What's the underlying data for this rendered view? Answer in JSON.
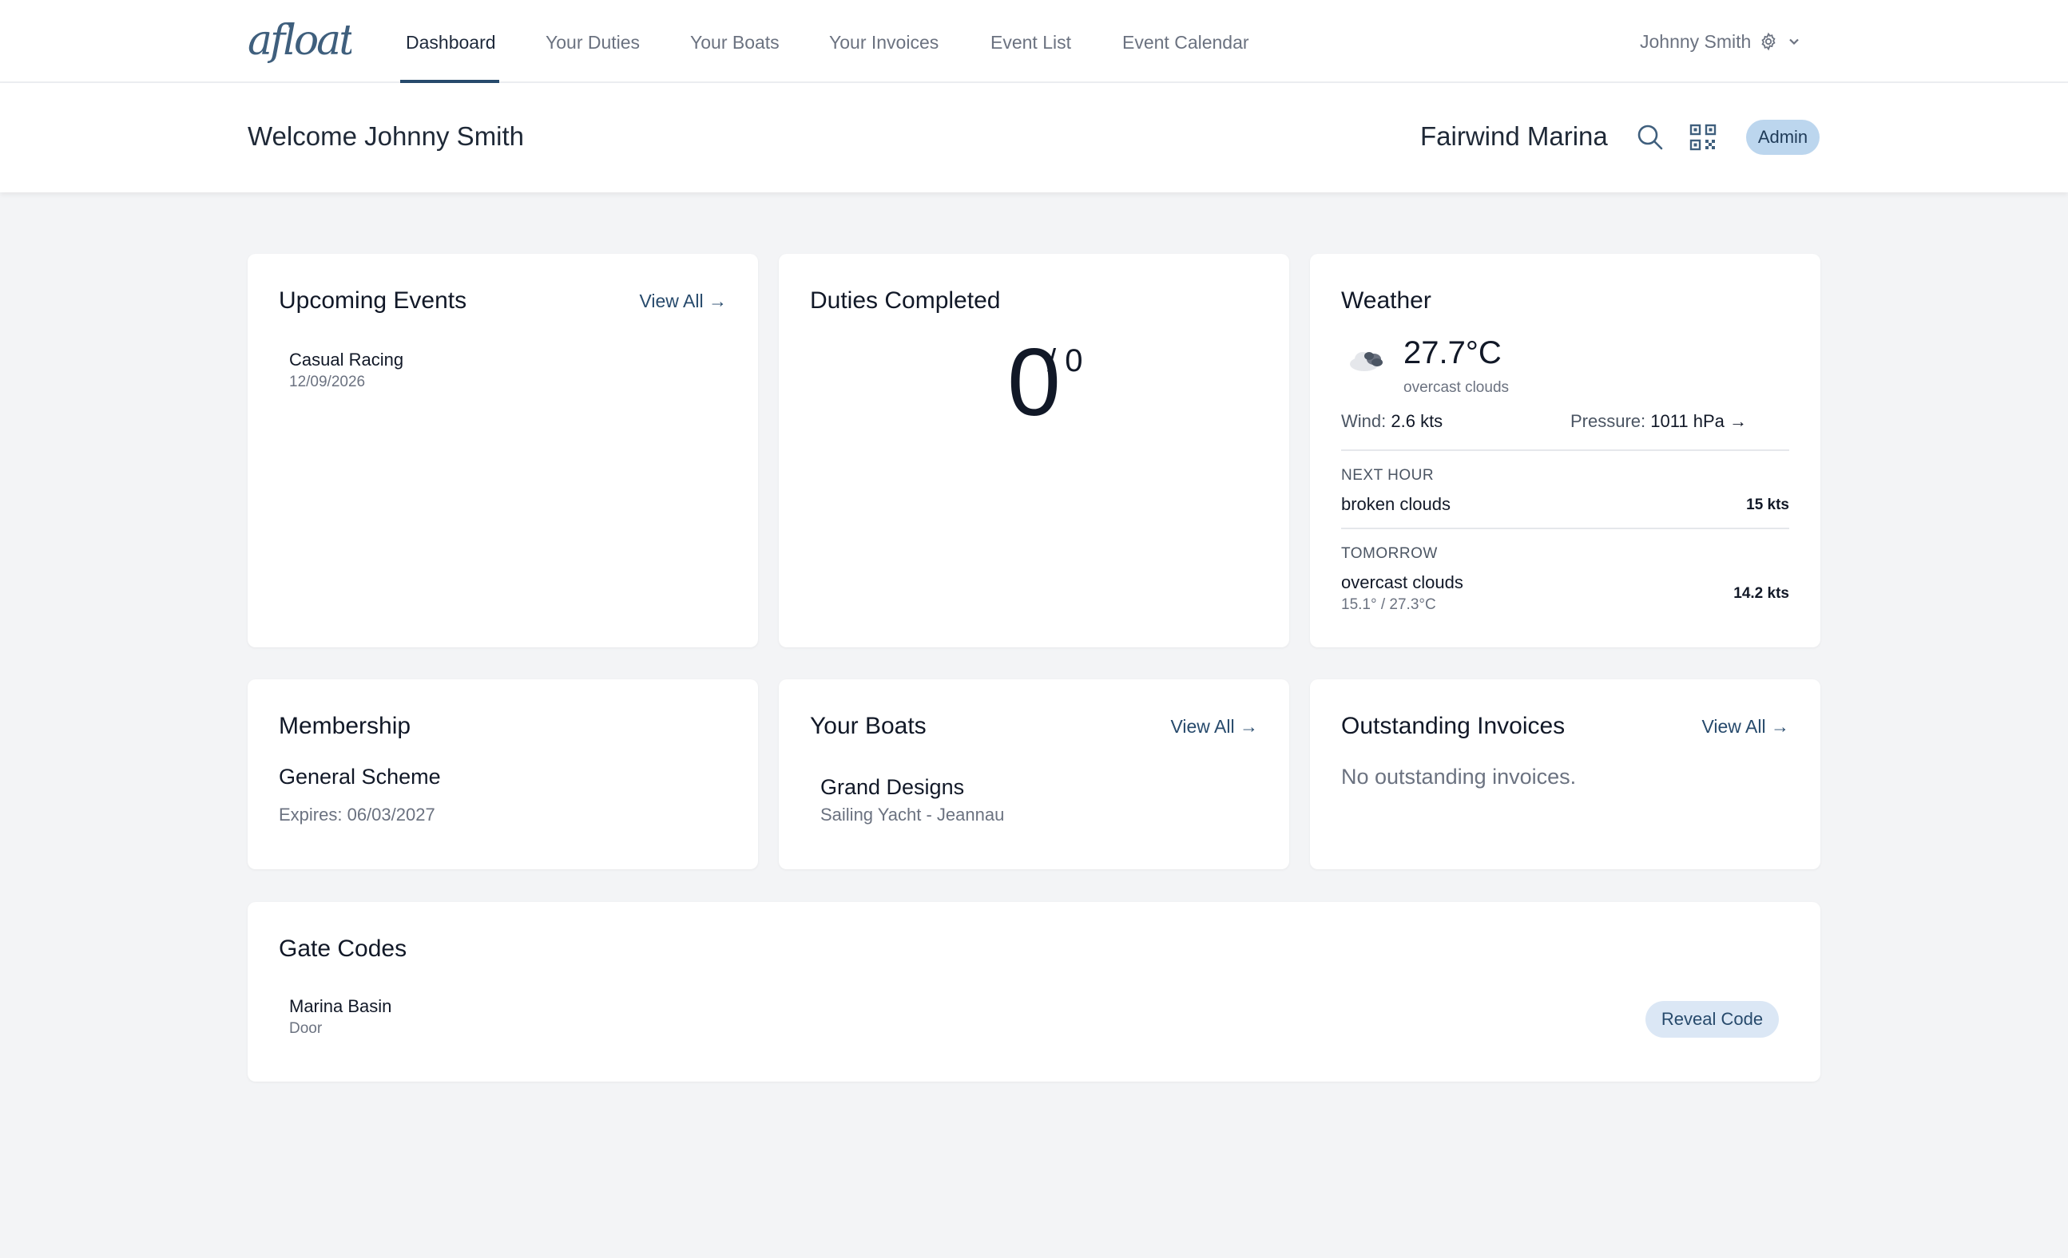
{
  "brand": {
    "logo_text": "afloat",
    "accent_color": "#274a6c"
  },
  "nav": {
    "items": [
      {
        "label": "Dashboard",
        "active": true
      },
      {
        "label": "Your Duties"
      },
      {
        "label": "Your Boats"
      },
      {
        "label": "Your Invoices"
      },
      {
        "label": "Event List"
      },
      {
        "label": "Event Calendar"
      }
    ],
    "user": {
      "name": "Johnny Smith",
      "icons": [
        "gear-icon",
        "chevron-down-icon"
      ]
    }
  },
  "header": {
    "welcome": "Welcome Johnny Smith",
    "club": "Fairwind Marina",
    "icons": [
      "search-icon",
      "qr-code-icon"
    ],
    "role_badge": "Admin"
  },
  "upcoming_events": {
    "title": "Upcoming Events",
    "view_all": "View All →",
    "items": [
      {
        "name": "Casual Racing",
        "date": "12/09/2026"
      }
    ]
  },
  "duties": {
    "title": "Duties Completed",
    "completed": "0",
    "total": "/ 0"
  },
  "weather": {
    "title": "Weather",
    "icon": "cloud-icon",
    "temp": "27.7°C",
    "desc": "overcast clouds",
    "wind_label": "Wind:",
    "wind_value": "2.6 kts",
    "pressure_label": "Pressure:",
    "pressure_value": "1011 hPa →",
    "next_hour": {
      "label": "NEXT HOUR",
      "desc": "broken clouds",
      "wind": "15 kts"
    },
    "tomorrow": {
      "label": "TOMORROW",
      "desc": "overcast clouds",
      "range": "15.1° / 27.3°C",
      "wind": "14.2 kts"
    }
  },
  "membership": {
    "title": "Membership",
    "scheme": "General Scheme",
    "expires": "Expires: 06/03/2027"
  },
  "boats": {
    "title": "Your Boats",
    "view_all": "View All →",
    "items": [
      {
        "name": "Grand Designs",
        "type": "Sailing Yacht - Jeannau"
      }
    ]
  },
  "invoices": {
    "title": "Outstanding Invoices",
    "view_all": "View All →",
    "empty": "No outstanding invoices."
  },
  "gate_codes": {
    "title": "Gate Codes",
    "items": [
      {
        "name": "Marina Basin",
        "type": "Door",
        "button": "Reveal Code"
      }
    ]
  }
}
